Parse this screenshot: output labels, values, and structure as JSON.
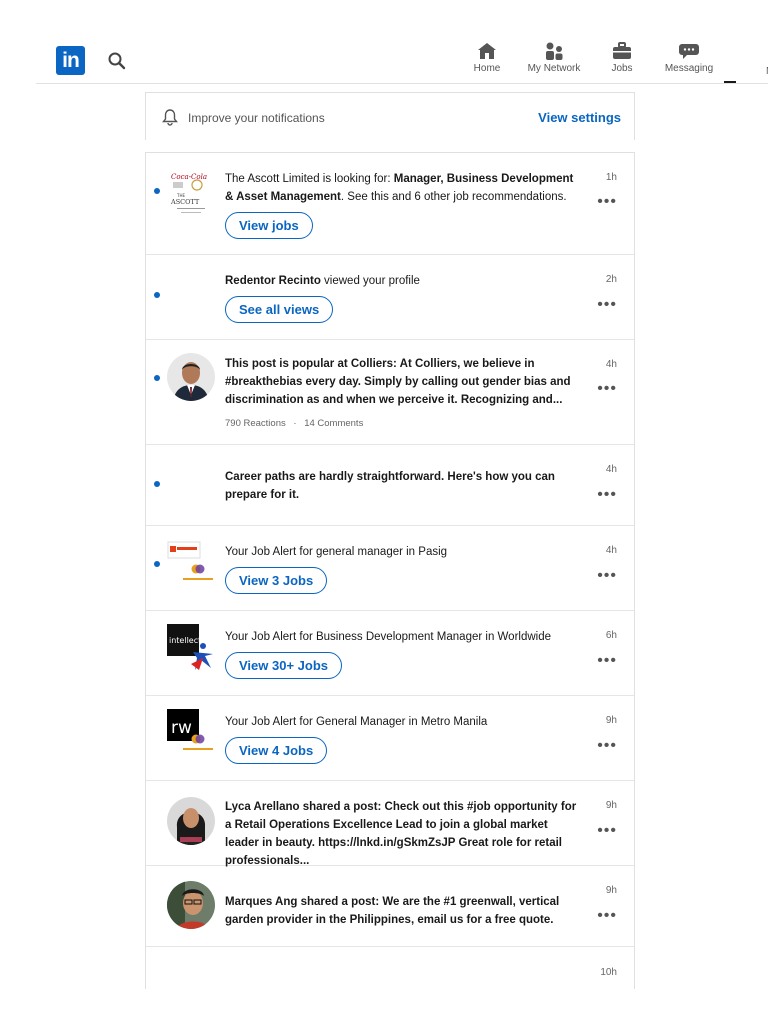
{
  "nav": {
    "items": [
      {
        "label": "Home",
        "icon": "home-icon"
      },
      {
        "label": "My Network",
        "icon": "network-icon"
      },
      {
        "label": "Jobs",
        "icon": "briefcase-icon"
      },
      {
        "label": "Messaging",
        "icon": "messaging-icon"
      }
    ],
    "cut_label": "N"
  },
  "improve": {
    "text": "Improve your notifications",
    "link": "View settings"
  },
  "notifications": [
    {
      "unread": true,
      "avatar": "ascott-logo",
      "time": "1h",
      "text_parts": [
        "The Ascott Limited is looking for: ",
        "Manager, Business Development & Asset Management",
        ". See this and 6 other job recommendations."
      ],
      "button": "View jobs"
    },
    {
      "unread": true,
      "avatar": "",
      "time": "2h",
      "text_parts": [
        "Redentor Recinto",
        " viewed your profile"
      ],
      "button": "See all views"
    },
    {
      "unread": true,
      "avatar": "man-in-suit-photo",
      "time": "4h",
      "text": "This post is popular at Colliers: At Colliers, we believe in #breakthebias every day. Simply by calling out gender bias and discrimination as and when we perceive it. Recognizing and...",
      "meta_reactions": "790 Reactions",
      "meta_sep": "·",
      "meta_comments": "14 Comments"
    },
    {
      "unread": true,
      "avatar": "",
      "time": "4h",
      "text": "Career paths are hardly straightforward. Here's how you can prepare for it."
    },
    {
      "unread": true,
      "avatar": "job-alert-logos",
      "time": "4h",
      "text": "Your Job Alert for general manager in Pasig",
      "button": "View 3 Jobs"
    },
    {
      "unread": false,
      "avatar": "intellect-logo",
      "time": "6h",
      "text": "Your Job Alert for Business Development Manager in Worldwide",
      "button": "View 30+ Jobs"
    },
    {
      "unread": false,
      "avatar": "rw-logo",
      "time": "9h",
      "text": "Your Job Alert for General Manager in Metro Manila",
      "button": "View 4 Jobs"
    },
    {
      "unread": false,
      "avatar": "woman-photo",
      "time": "9h",
      "text": "Lyca Arellano shared a post: Check out this #job opportunity for a Retail Operations Excellence Lead to join a global market leader in beauty. https://lnkd.in/gSkmZsJP Great role for retail professionals..."
    },
    {
      "unread": false,
      "avatar": "man-glasses-photo",
      "time": "9h",
      "text": "Marques Ang shared a post: We are the #1 greenwall, vertical garden provider in the Philippines, email us for a free quote."
    },
    {
      "unread": false,
      "avatar": "",
      "time": "10h"
    }
  ],
  "more_label": "•••",
  "logo_text": "in",
  "colors": {
    "accent": "#0a66c2",
    "border": "#e0e0e0"
  }
}
